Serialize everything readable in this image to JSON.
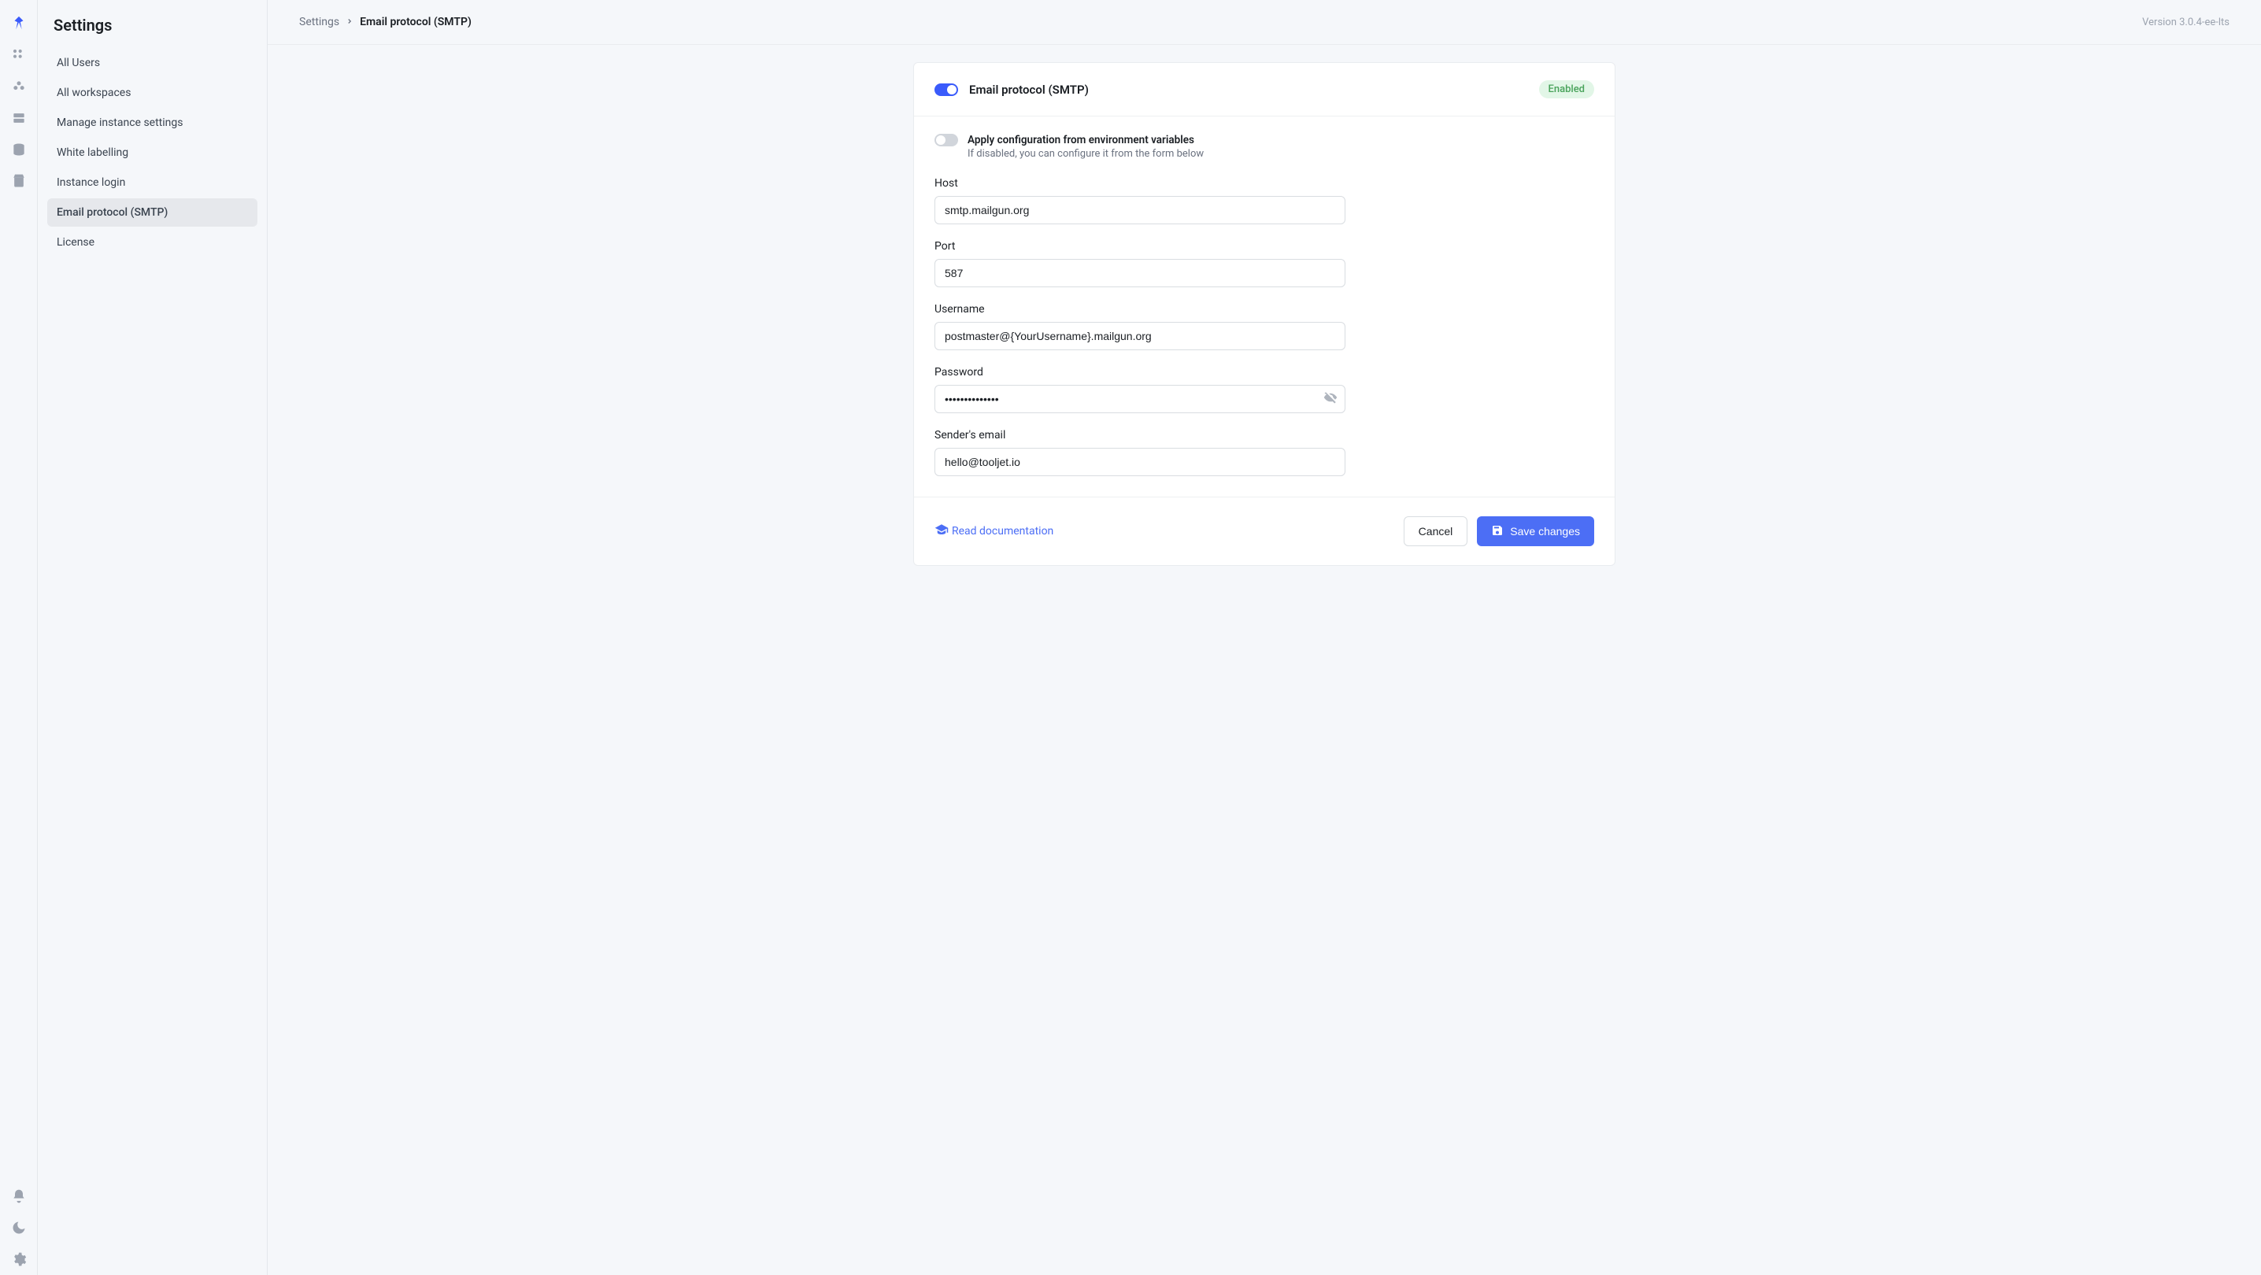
{
  "sidebar": {
    "title": "Settings",
    "items": [
      {
        "label": "All Users",
        "active": false
      },
      {
        "label": "All workspaces",
        "active": false
      },
      {
        "label": "Manage instance settings",
        "active": false
      },
      {
        "label": "White labelling",
        "active": false
      },
      {
        "label": "Instance login",
        "active": false
      },
      {
        "label": "Email protocol (SMTP)",
        "active": true
      },
      {
        "label": "License",
        "active": false
      }
    ]
  },
  "breadcrumbs": {
    "root": "Settings",
    "current": "Email protocol (SMTP)"
  },
  "version": "Version 3.0.4-ee-lts",
  "card": {
    "title": "Email protocol (SMTP)",
    "enabled_toggle": true,
    "status_badge": "Enabled",
    "env": {
      "toggle": false,
      "title": "Apply configuration from environment variables",
      "desc": "If disabled, you can configure it from the form below"
    },
    "fields": {
      "host_label": "Host",
      "host_value": "smtp.mailgun.org",
      "port_label": "Port",
      "port_value": "587",
      "username_label": "Username",
      "username_value": "postmaster@{YourUsername}.mailgun.org",
      "password_label": "Password",
      "password_value": "••••••••••••••",
      "sender_label": "Sender's email",
      "sender_value": "hello@tooljet.io"
    },
    "footer": {
      "doc_label": "Read documentation",
      "cancel_label": "Cancel",
      "save_label": "Save changes"
    }
  }
}
